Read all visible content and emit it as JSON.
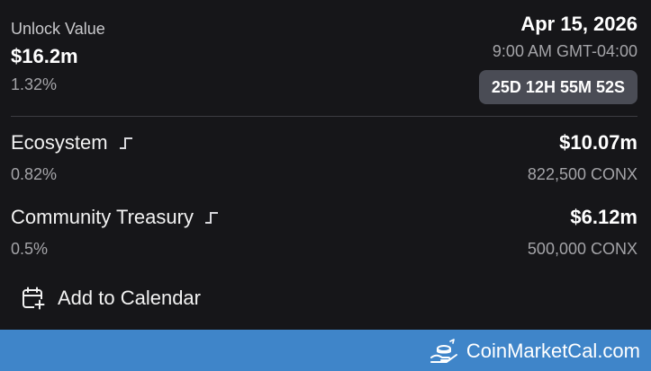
{
  "header": {
    "unlock_label": "Unlock Value",
    "unlock_value": "$16.2m",
    "unlock_pct": "1.32%",
    "date": "Apr 15, 2026",
    "time": "9:00 AM GMT-04:00",
    "countdown": "25D 12H 55M 52S"
  },
  "allocations": [
    {
      "name": "Ecosystem",
      "icon": "step-chart-icon",
      "pct": "0.82%",
      "usd": "$10.07m",
      "tokens": "822,500 CONX"
    },
    {
      "name": "Community Treasury",
      "icon": "step-chart-icon",
      "pct": "0.5%",
      "usd": "$6.12m",
      "tokens": "500,000 CONX"
    }
  ],
  "actions": {
    "add_to_calendar": "Add to Calendar",
    "calendar_icon": "calendar-plus-icon"
  },
  "footer": {
    "brand": "CoinMarketCal.com",
    "brand_icon": "coin-hand-icon",
    "color": "#3f85c9"
  },
  "colors": {
    "background": "#161619",
    "countdown_bg": "#4a4c55",
    "muted_text": "#a4a4a8"
  }
}
